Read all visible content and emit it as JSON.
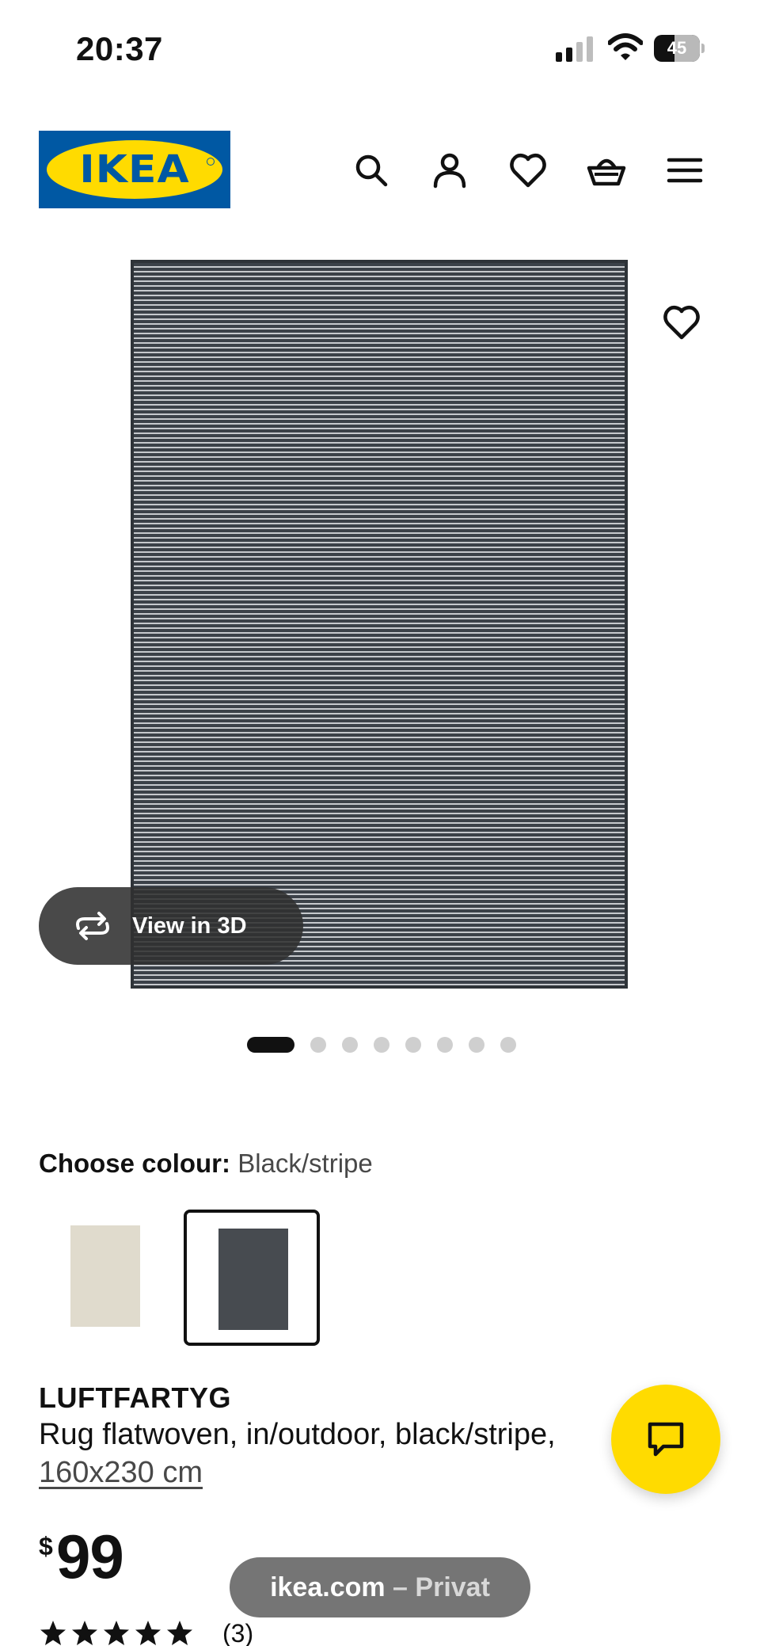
{
  "status_bar": {
    "time": "20:37",
    "battery_level": "45",
    "signal_bars": 2
  },
  "header": {
    "logo_text": "IKEA",
    "colors": {
      "brand_blue": "#0058a3",
      "brand_yellow": "#ffdb00"
    },
    "icons": [
      "search-icon",
      "account-icon",
      "heart-icon",
      "basket-icon",
      "menu-icon"
    ]
  },
  "gallery": {
    "view_3d_label": "View in 3D",
    "image_count": 8,
    "active_image": 1
  },
  "colour": {
    "label": "Choose colour:",
    "value": "Black/stripe",
    "options": [
      {
        "name": "beige",
        "color": "#e0dbcd"
      },
      {
        "name": "black-stripe",
        "color": "#474b50",
        "selected": true
      }
    ]
  },
  "product": {
    "name": "LUFTFARTYG",
    "description": "Rug flatwoven, in/outdoor, black/stripe,",
    "size": "160x230 cm",
    "currency": "$",
    "price": "99",
    "rating_stars": 5,
    "review_count": "(3)"
  },
  "browser": {
    "domain": "ikea.com",
    "separator": " – ",
    "mode": "Privat"
  }
}
